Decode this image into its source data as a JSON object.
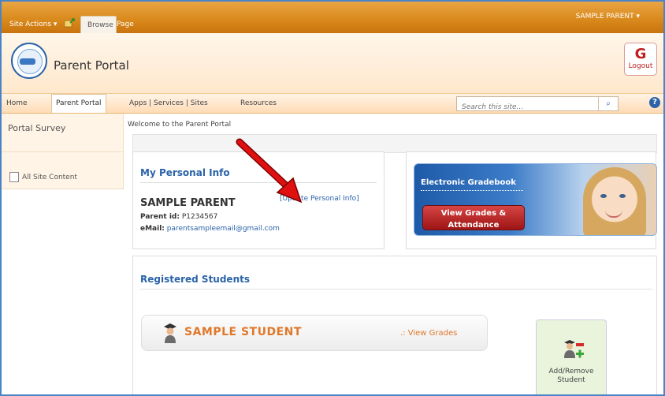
{
  "ribbon": {
    "site_actions": "Site Actions ▾",
    "tabs": [
      {
        "label": "Browse"
      },
      {
        "label": "Page"
      }
    ],
    "user": "SAMPLE PARENT ▾"
  },
  "header": {
    "title": "Parent Portal",
    "logout_label": "Logout"
  },
  "nav": {
    "items": [
      {
        "label": "Home"
      },
      {
        "label": "Parent Portal"
      },
      {
        "label": "Apps | Services | Sites"
      },
      {
        "label": "Resources"
      }
    ],
    "search_placeholder": "Search this site...",
    "help": "?"
  },
  "leftnav": {
    "items": [
      {
        "label": "Portal Survey"
      },
      {
        "label": "All Site Content"
      }
    ]
  },
  "main": {
    "welcome": "Welcome to the Parent Portal",
    "personal_info": {
      "title": "My Personal Info",
      "name": "SAMPLE PARENT",
      "update_link": "[Update Personal Info]",
      "parent_id_label": "Parent id:",
      "parent_id": "P1234567",
      "email_label": "eMail:",
      "email": "parentsampleemail@gmail.com"
    },
    "gradebook": {
      "title": "Electronic Gradebook",
      "button_line1": "View Grades &",
      "button_line2": "Attendance"
    },
    "students": {
      "title": "Registered Students",
      "student_name": "SAMPLE STUDENT",
      "view_grades": ".: View Grades",
      "add_remove_line1": "Add/Remove",
      "add_remove_line2": "Student"
    }
  },
  "colors": {
    "ribbon": "#d9881a",
    "link_blue": "#2a63a8",
    "student_orange": "#e0782a",
    "arrow_red": "#e01010"
  }
}
